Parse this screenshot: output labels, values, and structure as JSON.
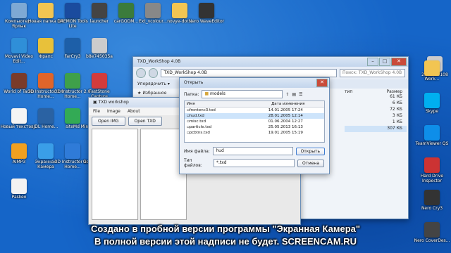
{
  "desktop_icons_left": [
    {
      "label": "Компьютер - Ярлык",
      "color": "#7ea9d4"
    },
    {
      "label": "Новая папка (2)",
      "color": "#f2c552"
    },
    {
      "label": "DAEMON Tools Lite",
      "color": "#1a4b9e"
    },
    {
      "label": "launcher",
      "color": "#444"
    },
    {
      "label": "carGODM...",
      "color": "#3b7b3b"
    },
    {
      "label": "Ext_vcolour...",
      "color": "#888"
    },
    {
      "label": "novye-dor...",
      "color": "#f2c552"
    },
    {
      "label": "Nero WaveEditor",
      "color": "#333"
    },
    {
      "label": "Movavi Video Edit...",
      "color": "#2f8fd8"
    },
    {
      "label": "Фрапс",
      "color": "#e8c13a"
    },
    {
      "label": "FarCry3",
      "color": "#1d5fa8"
    },
    {
      "label": "b8e745035a",
      "color": "#cccccc"
    },
    {
      "label": "World of Tanks",
      "color": "#7a3b2a"
    },
    {
      "label": "3D Instructor 2.0 Home...",
      "color": "#e0652a"
    },
    {
      "label": "3D Instructor 2.0 Home...",
      "color": "#3fa04a"
    },
    {
      "label": "FastStone Capture",
      "color": "#d23b3b"
    },
    {
      "label": "Новый текстов...",
      "color": "#f4f4f4"
    },
    {
      "label": "JDL Home...",
      "color": "#2a62a3"
    },
    {
      "label": "siteMd",
      "color": "#33aa55"
    },
    {
      "label": "Minecraft v1.7.10",
      "color": "#4b8a3a"
    },
    {
      "label": "AIMP3",
      "color": "#f0a020"
    },
    {
      "label": "Экранная Камера",
      "color": "#3a9ee8"
    },
    {
      "label": "3D Instructor 2.0 Home...",
      "color": "#2f7bd8"
    },
    {
      "label": "Google Chrome",
      "color": "#e94235"
    },
    {
      "label": "Paskeo",
      "color": "#f2f2f2"
    }
  ],
  "desktop_icons_right": [
    {
      "label": "2bc5095108",
      "color": "#cccccc"
    },
    {
      "label": "Work...",
      "color": "#f2c552"
    },
    {
      "label": "Skype",
      "color": "#00aff0"
    },
    {
      "label": "TeamViewer QS",
      "color": "#0e8ee9"
    },
    {
      "label": "Hard Drive Inspector",
      "color": "#c33"
    },
    {
      "label": "Nero Cry3",
      "color": "#333"
    },
    {
      "label": "Nero CoverDes...",
      "color": "#444"
    }
  ],
  "explorer": {
    "title": "TXD_WorkShop 4.0B",
    "path": "TXD_WorkShop 4.0B",
    "search_placeholder": "Поиск: TXD_WorkShop 4.0B",
    "organize": "Упорядочить",
    "favorites": "Избранное",
    "col_type": "тип",
    "col_size": "Размер",
    "sizes": [
      "61 КБ",
      "6 КБ",
      "72 КБ",
      "3 КБ",
      "1 КБ",
      "307 КБ"
    ]
  },
  "txd_app": {
    "title": "TXD workshop",
    "menu": [
      "File",
      "Image",
      "About"
    ],
    "open_img": "Open IMG",
    "open_txd": "Open TXD"
  },
  "dialog": {
    "title": "Открыть",
    "papka_label": "Папка:",
    "folder": "models",
    "col_name": "Имя",
    "col_date": "Дата изменения",
    "files": [
      {
        "name": "frontenc3.txd",
        "date": "14.01.2005 17:24"
      },
      {
        "name": "hud.txd",
        "date": "28.01.2005 12:14",
        "selected": true
      },
      {
        "name": "misc.txd",
        "date": "01.06.2004 12:27"
      },
      {
        "name": "particle.txd",
        "date": "25.05.2013 16:13"
      },
      {
        "name": "pcbtns.txd",
        "date": "19.01.2005 15:19"
      }
    ],
    "filename_label": "Имя файла:",
    "filename_value": "hud",
    "filetype_label": "Тип файлов:",
    "filetype_value": "*.txd",
    "open_button": "Открыть",
    "cancel_button": "Отмена"
  },
  "watermark": {
    "line1": "Создано в пробной версии программы \"Экранная Камера\"",
    "line2": "В полной версии этой надписи не будет. SCREENCAM.RU"
  }
}
